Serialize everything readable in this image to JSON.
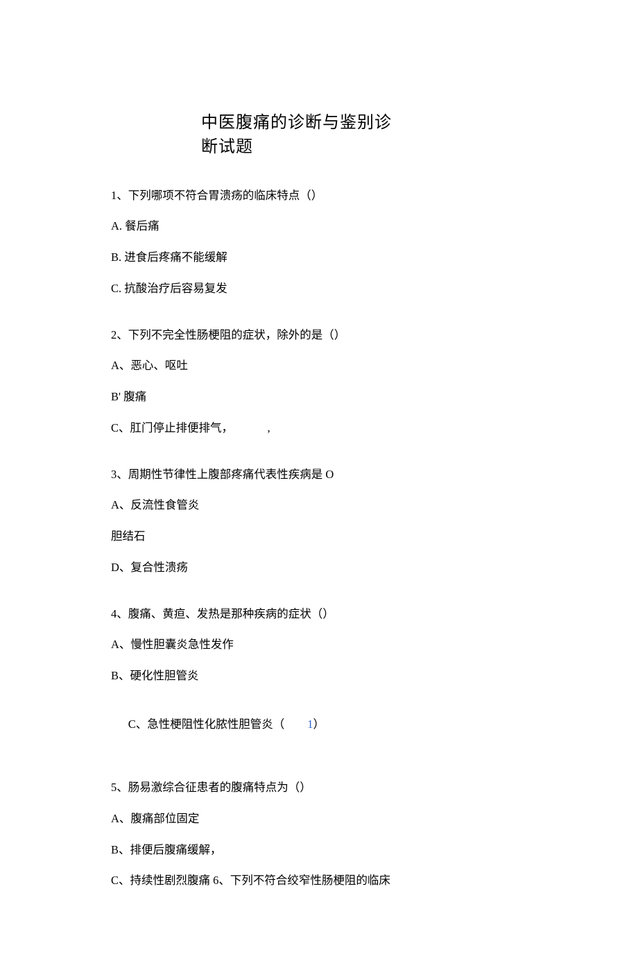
{
  "title": {
    "line1": "中医腹痛的诊断与鉴别诊",
    "line2": "断试题"
  },
  "q1": {
    "stem": "1、下列哪项不符合胃溃疡的临床特点（）",
    "a": "A. 餐后痛",
    "b": "B. 进食后疼痛不能缓解",
    "c": "C. 抗酸治疗后容易复发"
  },
  "q2": {
    "stem": "2、下列不完全性肠梗阻的症状，除外的是（）",
    "a": "A、恶心、呕吐",
    "b": "B' 腹痛",
    "c": "C、肛门停止排便排气，            ,"
  },
  "q3": {
    "stem": "3、周期性节律性上腹部疼痛代表性疾病是 O",
    "a": "A、反流性食管炎",
    "mid": "胆结石",
    "d": "D、复合性溃疡"
  },
  "q4": {
    "stem": "4、腹痛、黄疸、发热是那种疾病的症状（）",
    "a": "A、慢性胆囊炎急性发作",
    "b": "B、硬化性胆管炎",
    "c_pre": "C、急性梗阻性化脓性胆管炎（        ",
    "c_blue": "1",
    "c_post": "）"
  },
  "q5": {
    "stem": "5、肠易激综合征患者的腹痛特点为（）",
    "a": "A、腹痛部位固定",
    "b": "B、排便后腹痛缓解，",
    "c": "C、持续性剧烈腹痛 6、下列不符合绞窄性肠梗阻的临床"
  }
}
